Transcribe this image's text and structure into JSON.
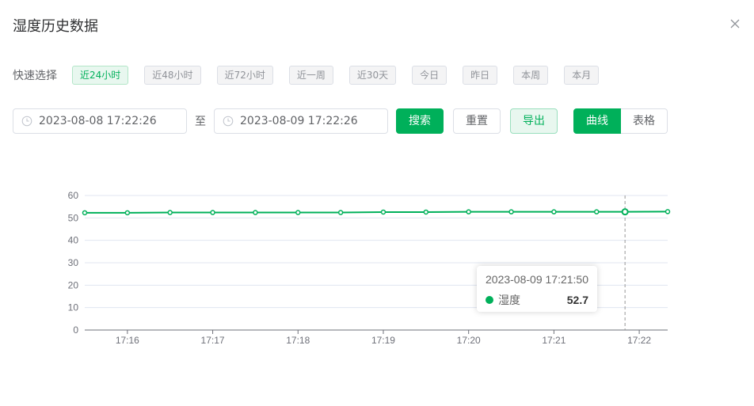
{
  "dialog": {
    "title": "湿度历史数据",
    "close_icon": "close-icon"
  },
  "quick_select": {
    "label": "快速选择",
    "options": [
      "近24小时",
      "近48小时",
      "近72小时",
      "近一周",
      "近30天",
      "今日",
      "昨日",
      "本周",
      "本月"
    ],
    "active_index": 0
  },
  "filter": {
    "start": "2023-08-08 17:22:26",
    "separator": "至",
    "end": "2023-08-09 17:22:26",
    "search_label": "搜索",
    "reset_label": "重置",
    "export_label": "导出",
    "view_toggle": [
      "曲线",
      "表格"
    ],
    "active_view": "曲线"
  },
  "colors": {
    "accent": "#00b05a",
    "grid": "#e0e6f1"
  },
  "chart_data": {
    "type": "line",
    "x": [
      "17:15:30",
      "17:16:00",
      "17:16:30",
      "17:17:00",
      "17:17:30",
      "17:18:00",
      "17:18:30",
      "17:19:00",
      "17:19:30",
      "17:20:00",
      "17:20:30",
      "17:21:00",
      "17:21:30",
      "17:21:50",
      "17:22:20"
    ],
    "series": [
      {
        "name": "湿度",
        "values": [
          52.3,
          52.3,
          52.4,
          52.4,
          52.4,
          52.4,
          52.4,
          52.6,
          52.6,
          52.7,
          52.7,
          52.7,
          52.7,
          52.7,
          52.8
        ]
      }
    ],
    "x_tick_labels": [
      "17:16",
      "17:17",
      "17:18",
      "17:19",
      "17:20",
      "17:21",
      "17:22"
    ],
    "ylim": [
      0,
      60
    ],
    "y_ticks": [
      0,
      10,
      20,
      30,
      40,
      50,
      60
    ],
    "grid": true,
    "tooltip": {
      "time": "2023-08-09 17:21:50",
      "name": "湿度",
      "value": "52.7"
    }
  }
}
